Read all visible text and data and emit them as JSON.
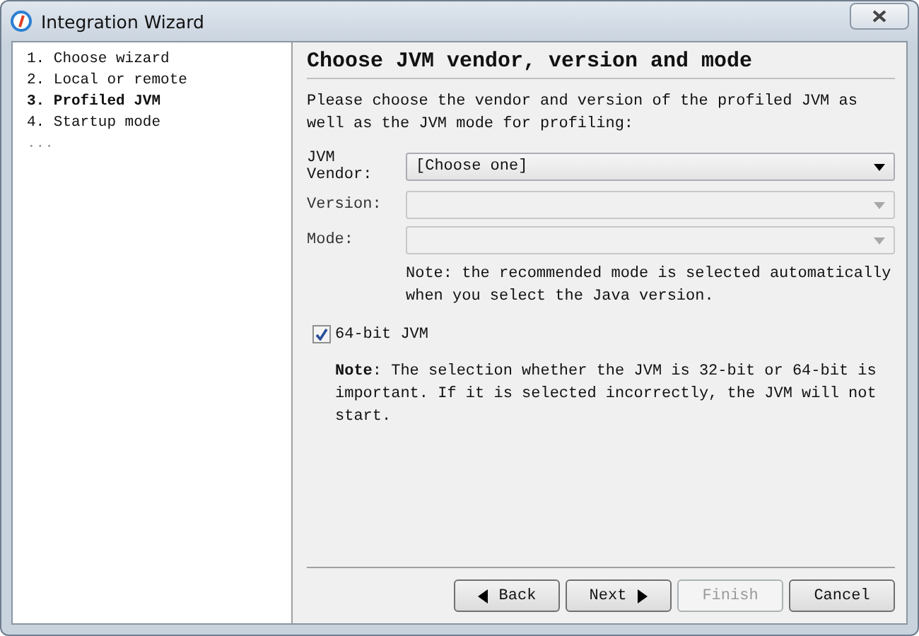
{
  "window": {
    "title": "Integration Wizard"
  },
  "steps": [
    {
      "label": "1. Choose wizard",
      "selected": false
    },
    {
      "label": "2. Local or remote",
      "selected": false
    },
    {
      "label": "3. Profiled JVM",
      "selected": true
    },
    {
      "label": "4. Startup mode",
      "selected": false
    }
  ],
  "steps_more": "...",
  "heading": "Choose JVM vendor, version and mode",
  "intro": "Please choose the vendor and version of the profiled JVM as well as the JVM mode for profiling:",
  "fields": [
    {
      "label": "JVM Vendor:",
      "value": "[Choose one]",
      "disabled": false
    },
    {
      "label": "Version:",
      "disabled": true
    },
    {
      "label": "Mode:",
      "disabled": true
    }
  ],
  "mode_note": "Note: the recommended mode is selected automatically when you select the Java version.",
  "checkbox": {
    "label": "64-bit JVM",
    "checked": true
  },
  "bit_note": "**Note**: The selection whether the JVM is 32-bit or 64-bit is important. If it is selected incorrectly, the JVM will not start.",
  "buttons": [
    {
      "label": "Back",
      "kind": "back",
      "disabled": false
    },
    {
      "label": "Next",
      "kind": "next",
      "disabled": false
    },
    {
      "label": "Finish",
      "kind": "plain",
      "disabled": true
    },
    {
      "label": "Cancel",
      "kind": "plain",
      "disabled": false
    }
  ]
}
